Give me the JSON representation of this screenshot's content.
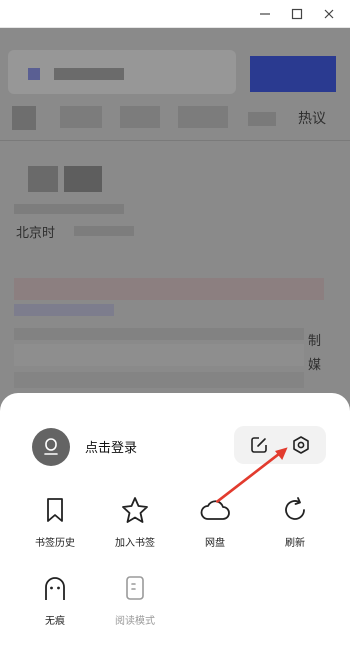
{
  "window": {
    "controls": [
      "minimize-icon",
      "maximize-icon",
      "close-icon"
    ]
  },
  "background": {
    "visible_text": {
      "tab_trending": "热议",
      "location_text": "北京时",
      "side_char_1": "制",
      "side_char_2": "媒"
    }
  },
  "sheet": {
    "account": {
      "login_label": "点击登录",
      "avatar_icon": "user-avatar-icon"
    },
    "top_actions": [
      {
        "name": "edit-icon"
      },
      {
        "name": "settings-icon"
      }
    ],
    "grid": [
      {
        "label": "书签历史",
        "icon": "bookmark-icon",
        "enabled": true
      },
      {
        "label": "加入书签",
        "icon": "star-icon",
        "enabled": true
      },
      {
        "label": "网盘",
        "icon": "cloud-icon",
        "enabled": true
      },
      {
        "label": "刷新",
        "icon": "refresh-icon",
        "enabled": true
      },
      {
        "label": "无痕",
        "icon": "incognito-icon",
        "enabled": true
      },
      {
        "label": "阅读模式",
        "icon": "reader-mode-icon",
        "enabled": false
      }
    ]
  },
  "colors": {
    "dim_overlay": "#8a8a8a",
    "annotation_arrow": "#e23b2e",
    "avatar": "#646464"
  }
}
